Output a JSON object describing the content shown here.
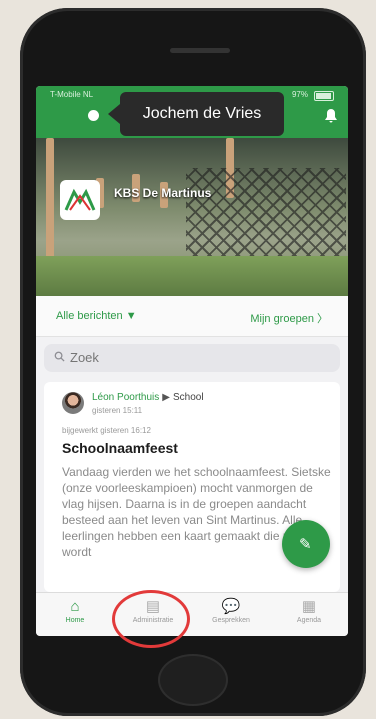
{
  "status_bar": {
    "carrier": "T-Mobile NL",
    "battery": "97%"
  },
  "header": {
    "account_name": "Jochem de Vries",
    "menu_icon": "circle-dot-icon",
    "notifications_icon": "bell-icon"
  },
  "school": {
    "name": "KBS De Martinus",
    "logo_icon": "school-logo"
  },
  "filters": {
    "all_posts": "Alle berichten ▼",
    "my_groups": "Mijn groepen 〉"
  },
  "search": {
    "placeholder": "Zoek"
  },
  "post": {
    "author": "Léon Poorthuis",
    "target": "School",
    "time": "gisteren 15:11",
    "updated": "bijgewerkt gisteren 16:12",
    "title": "Schoolnaamfeest",
    "body": "Vandaag vierden we het schoolnaamfeest. Sietske (onze voorleeskampioen) mocht vanmorgen de vlag hijsen. Daarna is in de groepen aandacht besteed aan het leven van Sint Martinus. Alle leerlingen hebben een kaart gemaakt die morgen wordt"
  },
  "compose_button": {
    "icon": "compose-icon"
  },
  "tabs": [
    {
      "label": "Home",
      "icon": "home-icon",
      "active": true
    },
    {
      "label": "Administratie",
      "icon": "inbox-icon",
      "active": false
    },
    {
      "label": "Gesprekken",
      "icon": "chat-icon",
      "active": false
    },
    {
      "label": "Agenda",
      "icon": "calendar-icon",
      "active": false
    }
  ],
  "colors": {
    "brand_green": "#2e9a48",
    "highlight_red": "#e23a3a"
  }
}
